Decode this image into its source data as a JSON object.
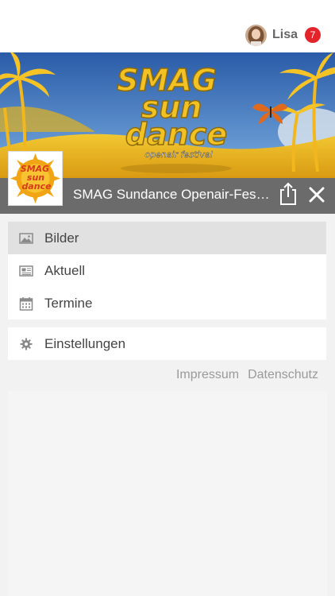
{
  "header": {
    "user_name": "Lisa",
    "notification_count": "7"
  },
  "event": {
    "title": "SMAG Sundance Openair-Festival",
    "banner_text": [
      "SMAG",
      "sun",
      "dance",
      "openair festival"
    ]
  },
  "menu": {
    "items": [
      {
        "label": "Bilder",
        "icon": "image-icon",
        "active": true
      },
      {
        "label": "Aktuell",
        "icon": "newspaper-icon",
        "active": false
      },
      {
        "label": "Termine",
        "icon": "calendar-icon",
        "active": false
      }
    ],
    "settings": {
      "label": "Einstellungen",
      "icon": "gear-icon"
    }
  },
  "footer": {
    "impressum": "Impressum",
    "datenschutz": "Datenschutz"
  },
  "colors": {
    "badge": "#e3242b",
    "titlebar": "#6b6b6b",
    "active_item": "#e1e1e1"
  }
}
